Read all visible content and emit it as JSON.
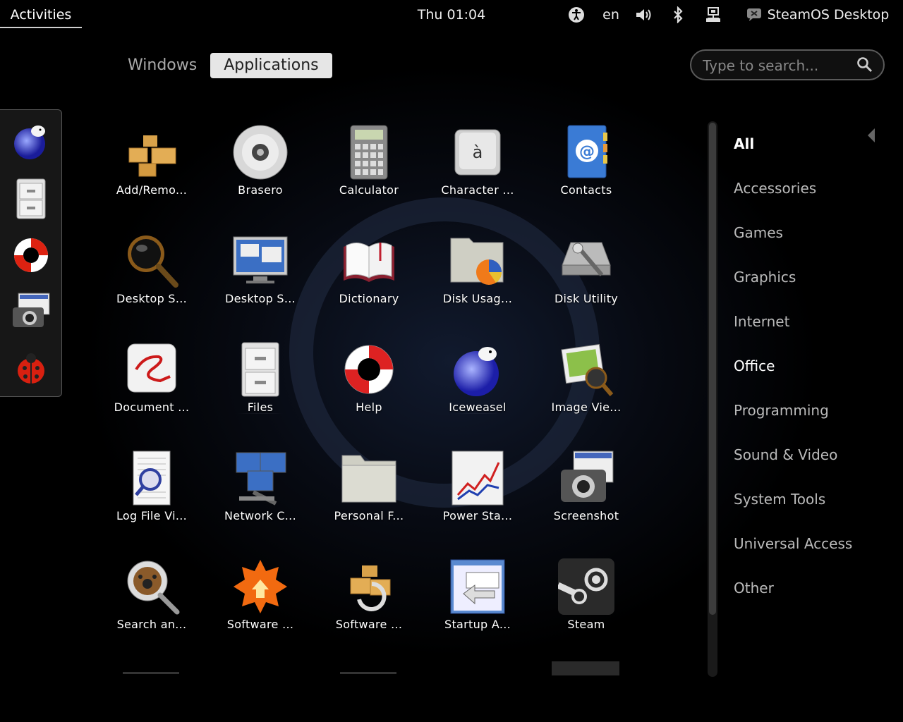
{
  "topbar": {
    "activities": "Activities",
    "clock": "Thu 01:04",
    "language": "en",
    "user_name": "SteamOS Desktop"
  },
  "overview": {
    "tabs": [
      {
        "label": "Windows",
        "active": false
      },
      {
        "label": "Applications",
        "active": true
      }
    ],
    "search_placeholder": "Type to search..."
  },
  "dash": {
    "items": [
      "Iceweasel",
      "Files",
      "Help",
      "Screenshot",
      "Bug reporter"
    ]
  },
  "apps": [
    {
      "label": "Add/Remo...",
      "icon": "boxes-icon"
    },
    {
      "label": "Brasero",
      "icon": "disc-icon"
    },
    {
      "label": "Calculator",
      "icon": "calculator-icon"
    },
    {
      "label": "Character ...",
      "icon": "character-map-icon"
    },
    {
      "label": "Contacts",
      "icon": "address-book-icon"
    },
    {
      "label": "Desktop S...",
      "icon": "magnifier-icon"
    },
    {
      "label": "Desktop S...",
      "icon": "monitor-icon"
    },
    {
      "label": "Dictionary",
      "icon": "book-icon"
    },
    {
      "label": "Disk Usag...",
      "icon": "folder-pie-icon"
    },
    {
      "label": "Disk Utility",
      "icon": "hard-disk-icon"
    },
    {
      "label": "Document ...",
      "icon": "document-viewer-icon"
    },
    {
      "label": "Files",
      "icon": "file-cabinet-icon",
      "running": true
    },
    {
      "label": "Help",
      "icon": "lifebuoy-icon"
    },
    {
      "label": "Iceweasel",
      "icon": "globe-icon",
      "running": true
    },
    {
      "label": "Image Vie...",
      "icon": "image-viewer-icon"
    },
    {
      "label": "Log File Vi...",
      "icon": "log-file-icon"
    },
    {
      "label": "Network C...",
      "icon": "network-icon"
    },
    {
      "label": "Personal F...",
      "icon": "folder-icon"
    },
    {
      "label": "Power Sta...",
      "icon": "chart-icon"
    },
    {
      "label": "Screenshot",
      "icon": "camera-icon"
    },
    {
      "label": "Search an...",
      "icon": "search-paw-icon"
    },
    {
      "label": "Software ...",
      "icon": "software-update-icon"
    },
    {
      "label": "Software ...",
      "icon": "software-sources-icon"
    },
    {
      "label": "Startup A...",
      "icon": "startup-icon"
    },
    {
      "label": "Steam",
      "icon": "steam-icon"
    }
  ],
  "categories": [
    {
      "label": "All",
      "state": "active"
    },
    {
      "label": "Accessories",
      "state": ""
    },
    {
      "label": "Games",
      "state": ""
    },
    {
      "label": "Graphics",
      "state": ""
    },
    {
      "label": "Internet",
      "state": ""
    },
    {
      "label": "Office",
      "state": "hilite"
    },
    {
      "label": "Programming",
      "state": ""
    },
    {
      "label": "Sound & Video",
      "state": ""
    },
    {
      "label": "System Tools",
      "state": ""
    },
    {
      "label": "Universal Access",
      "state": ""
    },
    {
      "label": "Other",
      "state": ""
    }
  ]
}
